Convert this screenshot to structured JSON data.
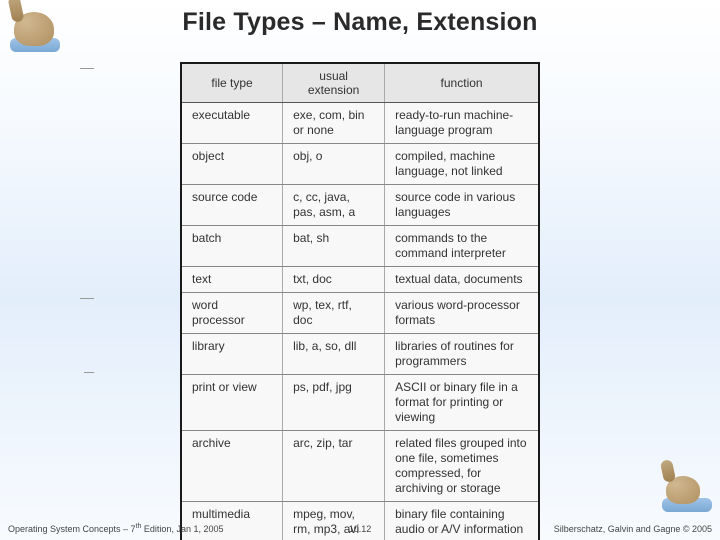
{
  "title": "File Types – Name, Extension",
  "table": {
    "headers": [
      "file type",
      "usual extension",
      "function"
    ],
    "rows": [
      {
        "type": "executable",
        "ext": "exe, com, bin or none",
        "func": "ready-to-run machine-language program"
      },
      {
        "type": "object",
        "ext": "obj, o",
        "func": "compiled, machine language, not linked"
      },
      {
        "type": "source code",
        "ext": "c, cc, java, pas, asm, a",
        "func": "source code in various languages"
      },
      {
        "type": "batch",
        "ext": "bat, sh",
        "func": "commands to the command interpreter"
      },
      {
        "type": "text",
        "ext": "txt, doc",
        "func": "textual data, documents"
      },
      {
        "type": "word processor",
        "ext": "wp, tex, rtf, doc",
        "func": "various word-processor formats"
      },
      {
        "type": "library",
        "ext": "lib, a, so, dll",
        "func": "libraries of routines for programmers"
      },
      {
        "type": "print or view",
        "ext": "ps, pdf, jpg",
        "func": "ASCII or binary file in a format for printing or viewing"
      },
      {
        "type": "archive",
        "ext": "arc, zip, tar",
        "func": "related files grouped into one file, sometimes compressed, for archiving or storage"
      },
      {
        "type": "multimedia",
        "ext": "mpeg, mov, rm, mp3, avi",
        "func": "binary file containing audio or A/V information"
      }
    ]
  },
  "footer": {
    "left_prefix": "Operating System Concepts – 7",
    "left_sup": "th",
    "left_suffix": " Edition, Jan 1, 2005",
    "center": "10.12",
    "right": "Silberschatz, Galvin and Gagne © 2005"
  }
}
